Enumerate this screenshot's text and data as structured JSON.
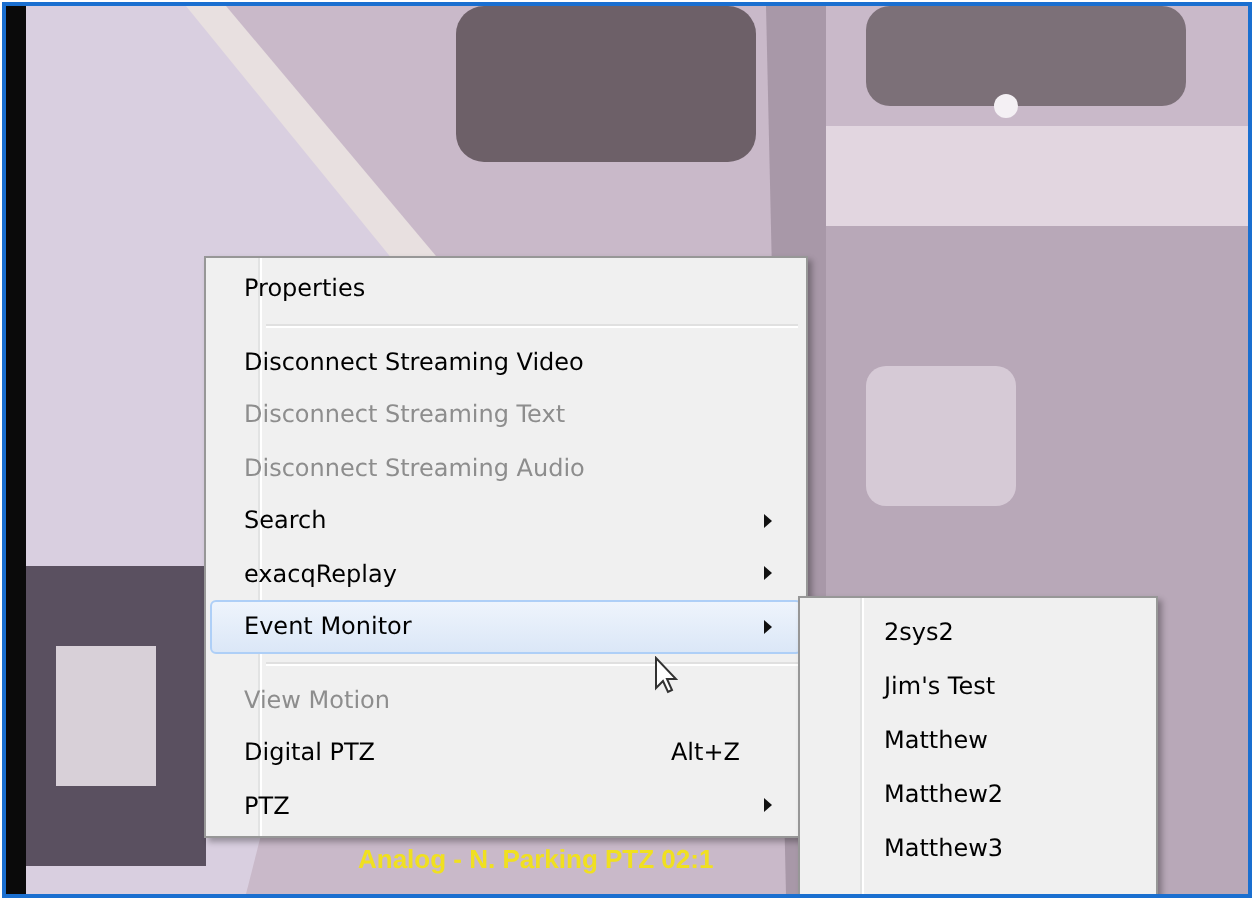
{
  "video": {
    "caption": "Analog - N. Parking PTZ 02:1"
  },
  "context_menu": {
    "items": [
      {
        "kind": "item",
        "label": "Properties",
        "disabled": false,
        "selected": false,
        "submenu": false
      },
      {
        "kind": "separator"
      },
      {
        "kind": "item",
        "label": "Disconnect Streaming Video",
        "disabled": false,
        "selected": false,
        "submenu": false
      },
      {
        "kind": "item",
        "label": "Disconnect Streaming Text",
        "disabled": true,
        "selected": false,
        "submenu": false
      },
      {
        "kind": "item",
        "label": "Disconnect Streaming Audio",
        "disabled": true,
        "selected": false,
        "submenu": false
      },
      {
        "kind": "item",
        "label": "Search",
        "disabled": false,
        "selected": false,
        "submenu": true
      },
      {
        "kind": "item",
        "label": "exacqReplay",
        "disabled": false,
        "selected": false,
        "submenu": true
      },
      {
        "kind": "item",
        "label": "Event Monitor",
        "disabled": false,
        "selected": true,
        "submenu": true
      },
      {
        "kind": "separator"
      },
      {
        "kind": "item",
        "label": "View Motion",
        "disabled": true,
        "selected": false,
        "submenu": false
      },
      {
        "kind": "item",
        "label": "Digital PTZ",
        "shortcut": "Alt+Z",
        "disabled": false,
        "selected": false,
        "submenu": false
      },
      {
        "kind": "item",
        "label": "PTZ",
        "disabled": false,
        "selected": false,
        "submenu": true
      }
    ]
  },
  "submenu": {
    "items": [
      "2sys2",
      "Jim's Test",
      "Matthew",
      "Matthew2",
      "Matthew3"
    ]
  }
}
